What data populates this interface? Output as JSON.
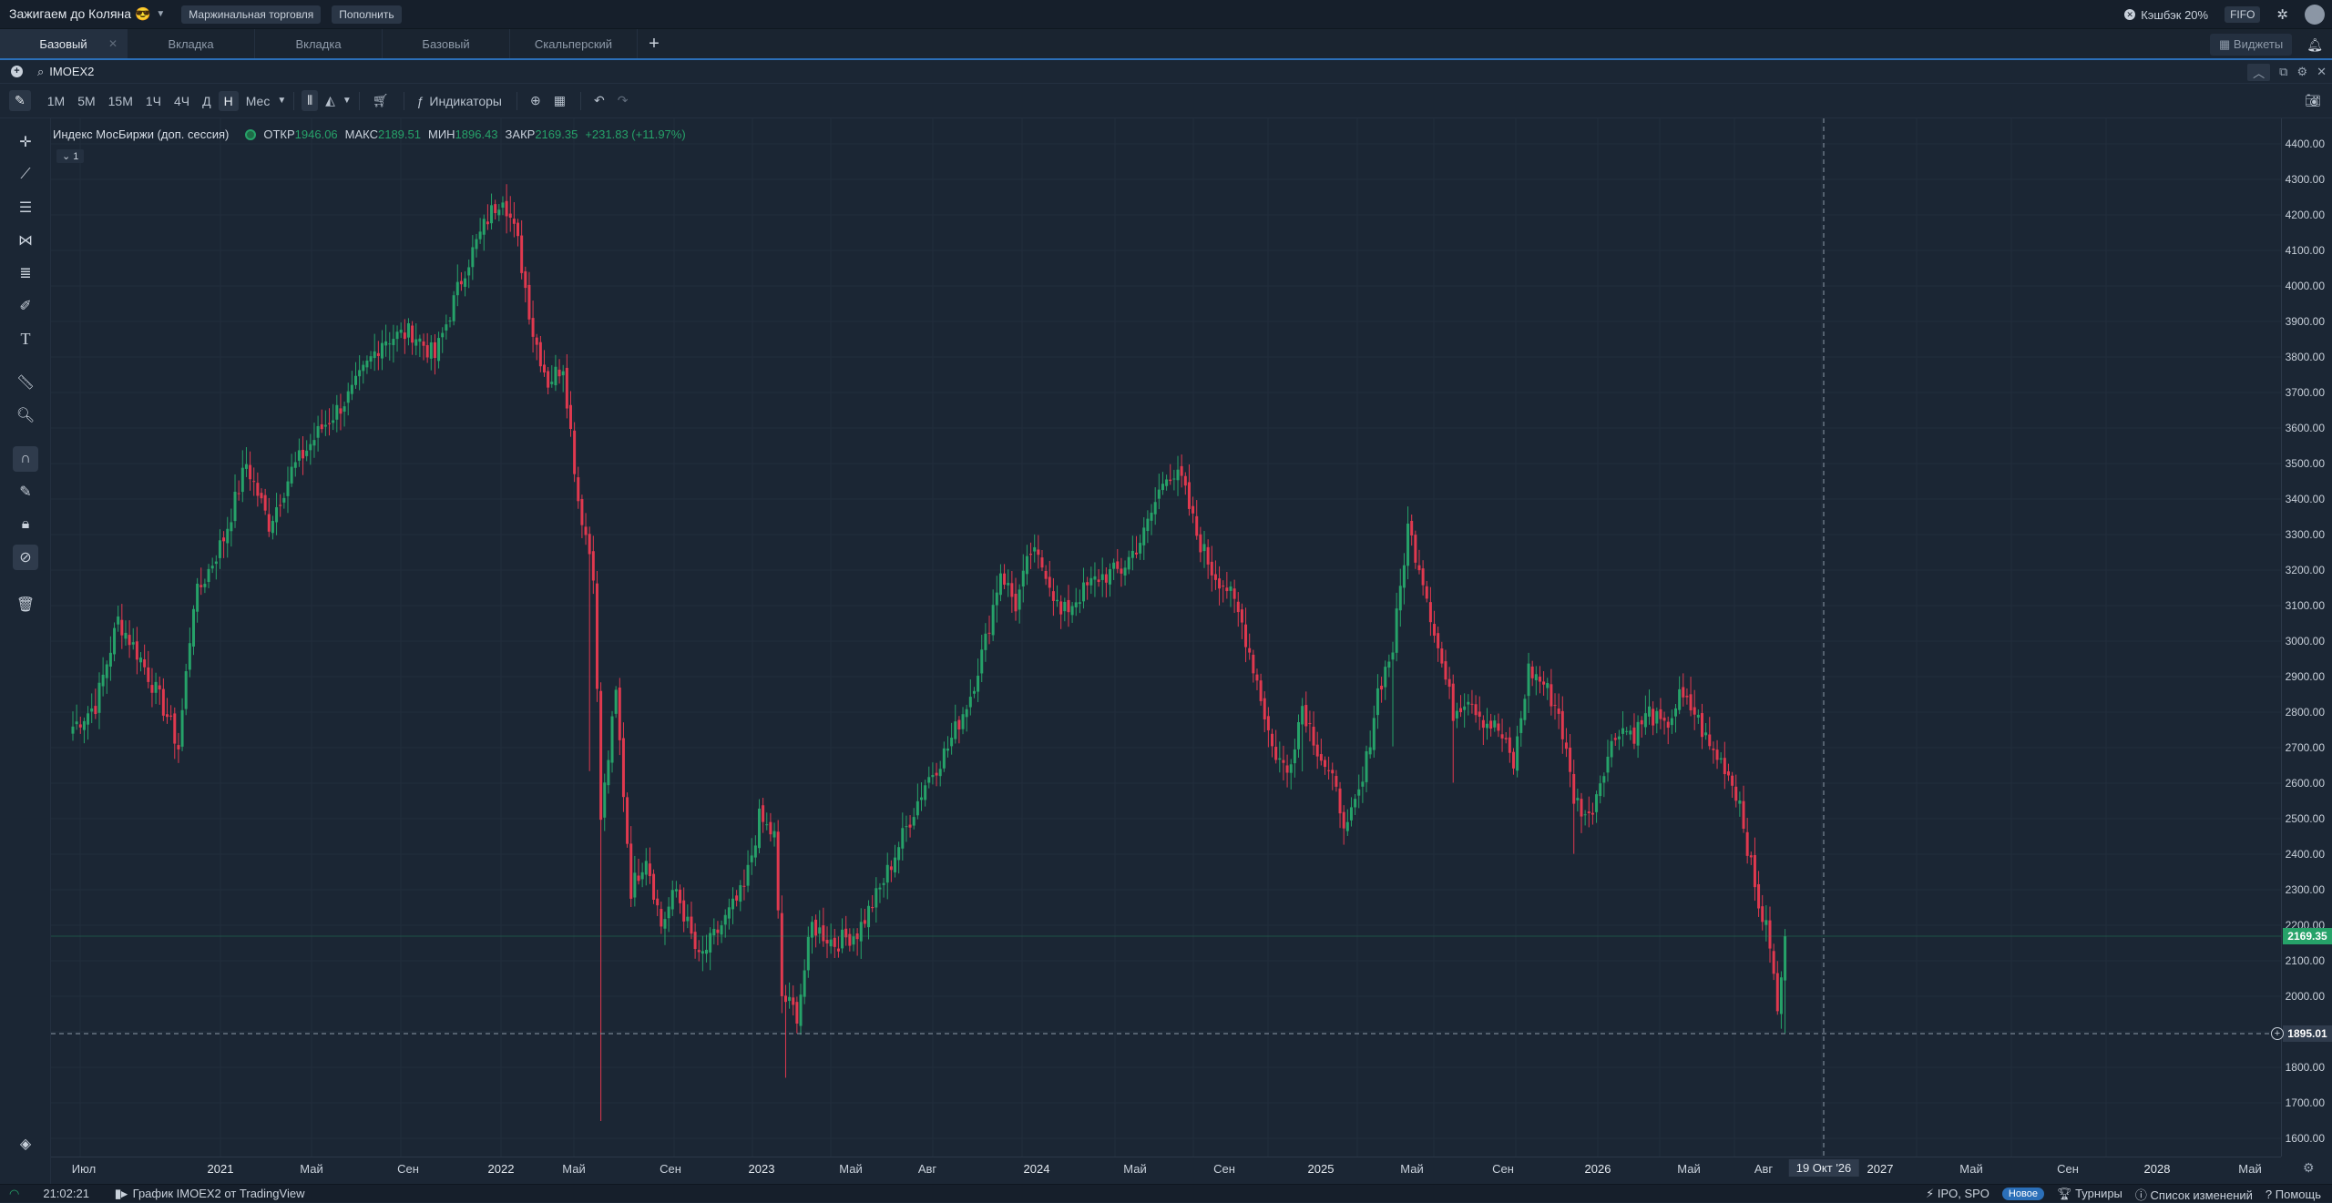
{
  "topbar": {
    "account": "Зажигаем до Коляна 😎",
    "margin_label": "Маржинальная торговля",
    "deposit_label": "Пополнить",
    "cashback": "Кэшбэк 20%",
    "fifo": "FIFO"
  },
  "tabs": [
    {
      "label": "Базовый"
    },
    {
      "label": "Вкладка"
    },
    {
      "label": "Вкладка"
    },
    {
      "label": "Базовый"
    },
    {
      "label": "Скальперский"
    }
  ],
  "widgets_label": "Виджеты",
  "search": {
    "ticker": "IMOEX2"
  },
  "toolbar": {
    "timeframes": [
      "1М",
      "5М",
      "15М",
      "1Ч",
      "4Ч",
      "Д",
      "Н",
      "Мес"
    ],
    "active_timeframe": "Н",
    "indicators_label": "Индикаторы"
  },
  "legend": {
    "title": "Индекс МосБиржи (доп. сессия)",
    "open_label": "ОТКР",
    "open": "1946.06",
    "high_label": "МАКС",
    "high": "2189.51",
    "low_label": "МИН",
    "low": "1896.43",
    "close_label": "ЗАКР",
    "close": "2169.35",
    "change": "+231.83 (+11.97%)",
    "collapse": "1"
  },
  "colors": {
    "up": "#26a269",
    "down": "#e0394f",
    "bg": "#1b2634",
    "accent": "#2b6fb8"
  },
  "chart_data": {
    "type": "candlestick",
    "ylim": [
      1550,
      4450
    ],
    "yticks": [
      1600,
      1700,
      1800,
      1900,
      2000,
      2100,
      2200,
      2300,
      2400,
      2500,
      2600,
      2700,
      2800,
      2900,
      3000,
      3100,
      3200,
      3300,
      3400,
      3500,
      3600,
      3700,
      3800,
      3900,
      4000,
      4100,
      4200,
      4300,
      4400
    ],
    "last_price": "2169.35",
    "crosshair_price": "1895.01",
    "crosshair_date": "19 Окт '26",
    "x_ticks": [
      "Июл",
      "2021",
      "Май",
      "Сен",
      "2022",
      "Май",
      "Сен",
      "2023",
      "Май",
      "Авг",
      "2024",
      "Май",
      "Сен",
      "2025",
      "Май",
      "Сен",
      "2026",
      "Май",
      "Авг",
      "2027",
      "Май",
      "Сен",
      "2028",
      "Май"
    ],
    "anchors": [
      [
        0,
        2760
      ],
      [
        6,
        2820
      ],
      [
        12,
        3060
      ],
      [
        18,
        2950
      ],
      [
        25,
        2790
      ],
      [
        28,
        2700
      ],
      [
        32,
        3110
      ],
      [
        40,
        3290
      ],
      [
        46,
        3500
      ],
      [
        52,
        3330
      ],
      [
        58,
        3480
      ],
      [
        66,
        3600
      ],
      [
        74,
        3700
      ],
      [
        82,
        3850
      ],
      [
        90,
        3870
      ],
      [
        96,
        3800
      ],
      [
        104,
        4050
      ],
      [
        110,
        4190
      ],
      [
        114,
        4260
      ],
      [
        118,
        4120
      ],
      [
        122,
        3870
      ],
      [
        126,
        3730
      ],
      [
        130,
        3780
      ],
      [
        134,
        3400
      ],
      [
        138,
        3200
      ],
      [
        140,
        2500
      ],
      [
        144,
        2850
      ],
      [
        148,
        2300
      ],
      [
        152,
        2400
      ],
      [
        156,
        2200
      ],
      [
        160,
        2300
      ],
      [
        166,
        2100
      ],
      [
        172,
        2200
      ],
      [
        178,
        2300
      ],
      [
        182,
        2500
      ],
      [
        186,
        2450
      ],
      [
        188,
        2000
      ],
      [
        192,
        1950
      ],
      [
        196,
        2200
      ],
      [
        202,
        2150
      ],
      [
        208,
        2180
      ],
      [
        214,
        2300
      ],
      [
        220,
        2450
      ],
      [
        226,
        2600
      ],
      [
        232,
        2700
      ],
      [
        238,
        2850
      ],
      [
        242,
        3000
      ],
      [
        246,
        3200
      ],
      [
        250,
        3100
      ],
      [
        254,
        3250
      ],
      [
        258,
        3200
      ],
      [
        262,
        3070
      ],
      [
        266,
        3120
      ],
      [
        272,
        3180
      ],
      [
        278,
        3200
      ],
      [
        284,
        3300
      ],
      [
        290,
        3480
      ],
      [
        294,
        3450
      ],
      [
        298,
        3300
      ],
      [
        302,
        3200
      ],
      [
        306,
        3150
      ],
      [
        310,
        3050
      ],
      [
        314,
        2890
      ],
      [
        318,
        2700
      ],
      [
        322,
        2630
      ],
      [
        326,
        2820
      ],
      [
        330,
        2700
      ],
      [
        334,
        2600
      ],
      [
        338,
        2470
      ],
      [
        342,
        2600
      ],
      [
        346,
        2860
      ],
      [
        350,
        2980
      ],
      [
        354,
        3320
      ],
      [
        358,
        3180
      ],
      [
        362,
        2980
      ],
      [
        366,
        2800
      ],
      [
        370,
        2850
      ],
      [
        374,
        2780
      ],
      [
        378,
        2750
      ],
      [
        382,
        2650
      ],
      [
        386,
        2920
      ],
      [
        390,
        2880
      ],
      [
        394,
        2800
      ],
      [
        398,
        2560
      ],
      [
        402,
        2500
      ],
      [
        406,
        2650
      ],
      [
        410,
        2760
      ],
      [
        414,
        2740
      ],
      [
        418,
        2800
      ],
      [
        422,
        2750
      ],
      [
        426,
        2840
      ],
      [
        430,
        2800
      ],
      [
        434,
        2700
      ],
      [
        438,
        2650
      ],
      [
        442,
        2550
      ],
      [
        446,
        2300
      ],
      [
        450,
        2150
      ],
      [
        452,
        1950
      ],
      [
        454,
        2169
      ]
    ],
    "series_length": 455
  },
  "status": {
    "time": "21:02:21",
    "chart_credit": "График IMOEX2 от TradingView",
    "ipo": "IPO, SPO",
    "new_badge": "Новое",
    "tournaments": "Турниры",
    "changelog": "Список изменений",
    "help": "Помощь"
  }
}
